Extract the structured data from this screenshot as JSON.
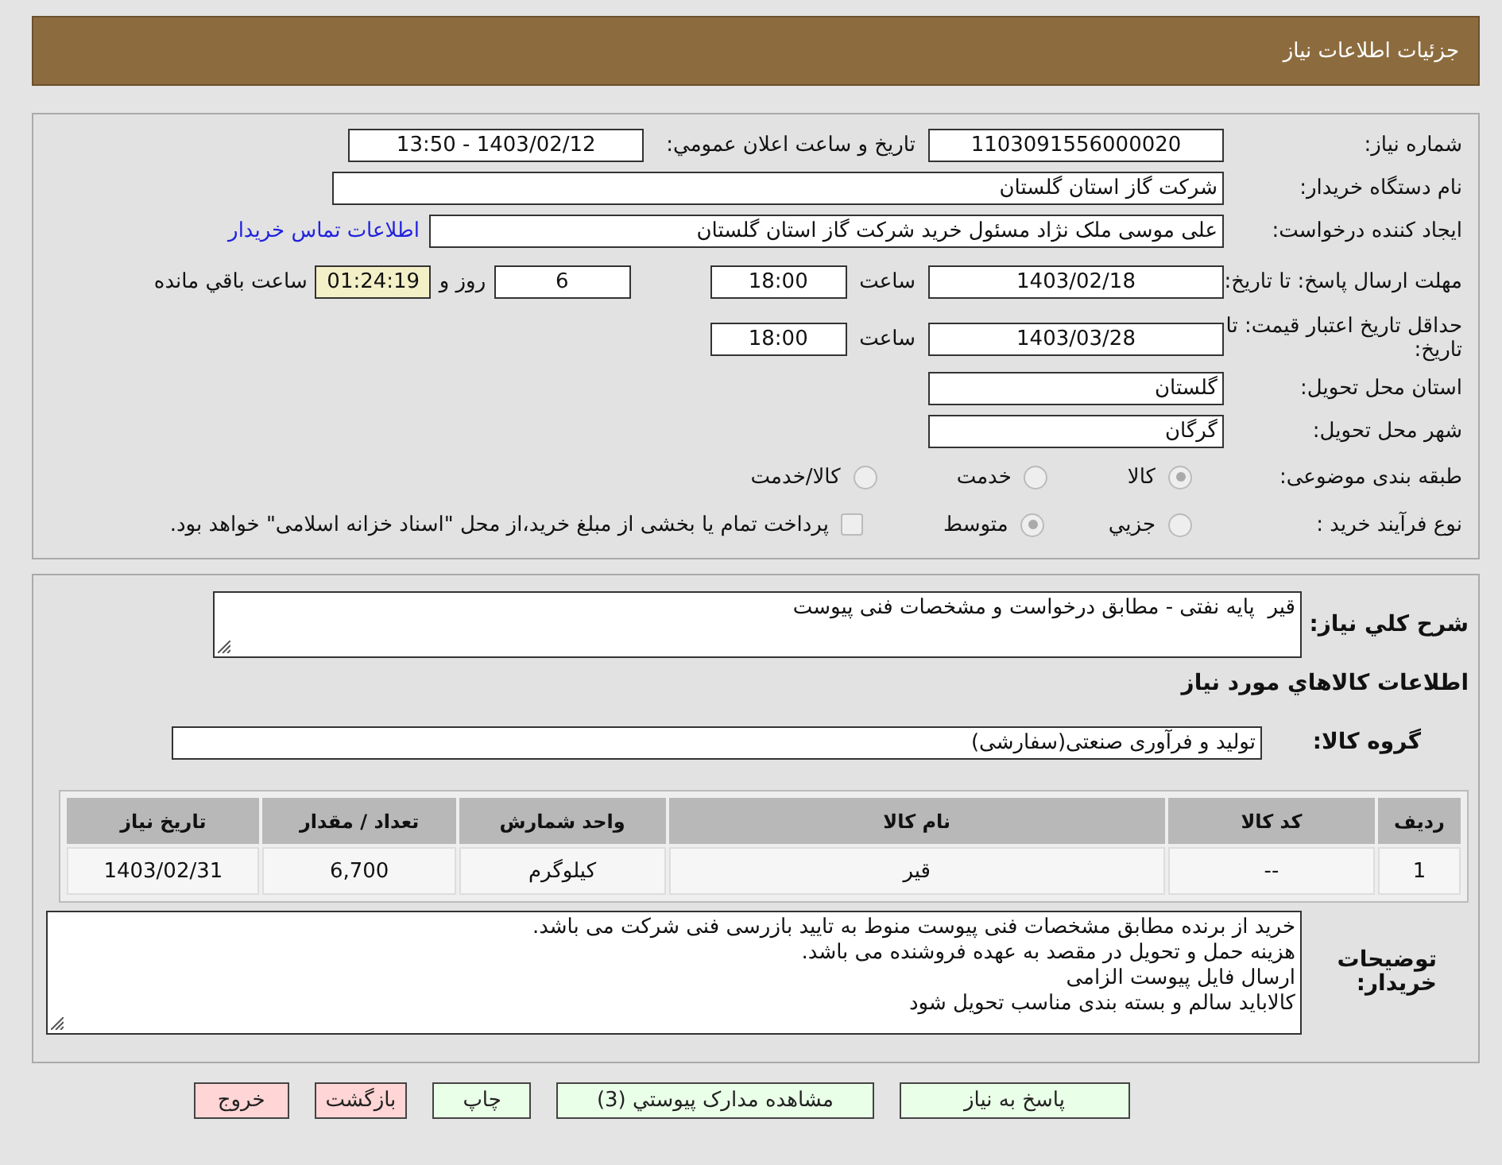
{
  "header": {
    "title": "جزئیات اطلاعات نیاز"
  },
  "need_number": {
    "label": "شماره نیاز:",
    "value": "1103091556000020"
  },
  "announce": {
    "label": "تاریخ و ساعت اعلان عمومي:",
    "value": "1403/02/12 - 13:50"
  },
  "buyer": {
    "label": "نام دستگاه خریدار:",
    "value": "شرکت گاز استان گلستان"
  },
  "creator": {
    "label": "ایجاد کننده درخواست:",
    "value": "علی موسی ملک نژاد مسئول خرید شرکت گاز استان گلستان",
    "link": "اطلاعات تماس خریدار"
  },
  "deadline": {
    "label": "مهلت ارسال پاسخ: تا تاریخ:",
    "date": "1403/02/18",
    "time_label": "ساعت",
    "time": "18:00",
    "days": "6",
    "days_label": "روز و",
    "remaining": "01:24:19",
    "remaining_label": "ساعت باقي مانده"
  },
  "validity": {
    "label": "حداقل تاریخ اعتبار قیمت: تا تاریخ:",
    "date": "1403/03/28",
    "time_label": "ساعت",
    "time": "18:00"
  },
  "province": {
    "label": "استان محل تحویل:",
    "value": "گلستان"
  },
  "city": {
    "label": "شهر محل تحویل:",
    "value": "گرگان"
  },
  "category": {
    "label": "طبقه بندی موضوعی:",
    "options": [
      {
        "label": "کالا",
        "selected": true
      },
      {
        "label": "خدمت",
        "selected": false
      },
      {
        "label": "کالا/خدمت",
        "selected": false
      }
    ]
  },
  "process": {
    "label": "نوع فرآیند خرید :",
    "options": [
      {
        "label": "جزيي",
        "selected": false
      },
      {
        "label": "متوسط",
        "selected": true
      }
    ],
    "treasury": {
      "checked": false,
      "label": "پرداخت تمام یا بخشی از مبلغ خرید،از محل \"اسناد خزانه اسلامی\" خواهد بود."
    }
  },
  "description": {
    "label": "شرح كلي نياز:",
    "value": "قیر  پایه نفتی - مطابق درخواست و مشخصات فنی پیوست"
  },
  "goods_heading": "اطلاعات كالاهاي مورد نياز",
  "goods_group": {
    "label": "گروه کالا:",
    "value": "تولید و فرآوری صنعتی(سفارشی)"
  },
  "table": {
    "columns": [
      "ردیف",
      "کد کالا",
      "نام کالا",
      "واحد شمارش",
      "تعداد / مقدار",
      "تاریخ نیاز"
    ],
    "rows": [
      [
        "1",
        "--",
        "قیر",
        "کیلوگرم",
        "6,700",
        "1403/02/31"
      ]
    ]
  },
  "notes": {
    "label": "توضیحات خریدار:",
    "lines": [
      "خرید از برنده مطابق مشخصات فنی پیوست منوط به تایید بازرسی فنی شرکت می باشد.",
      "هزینه حمل و تحویل در مقصد به عهده فروشنده می باشد.",
      "ارسال فایل پیوست الزامی",
      "کالاباید سالم و بسته بندی مناسب تحویل شود"
    ]
  },
  "buttons": [
    {
      "label": "پاسخ به نیاز",
      "kind": "action"
    },
    {
      "label": "مشاهده مدارک پیوستي (3)",
      "kind": "action"
    },
    {
      "label": "چاپ",
      "kind": "action"
    },
    {
      "label": "بازگشت",
      "kind": "exit"
    },
    {
      "label": "خروج",
      "kind": "exit"
    }
  ]
}
